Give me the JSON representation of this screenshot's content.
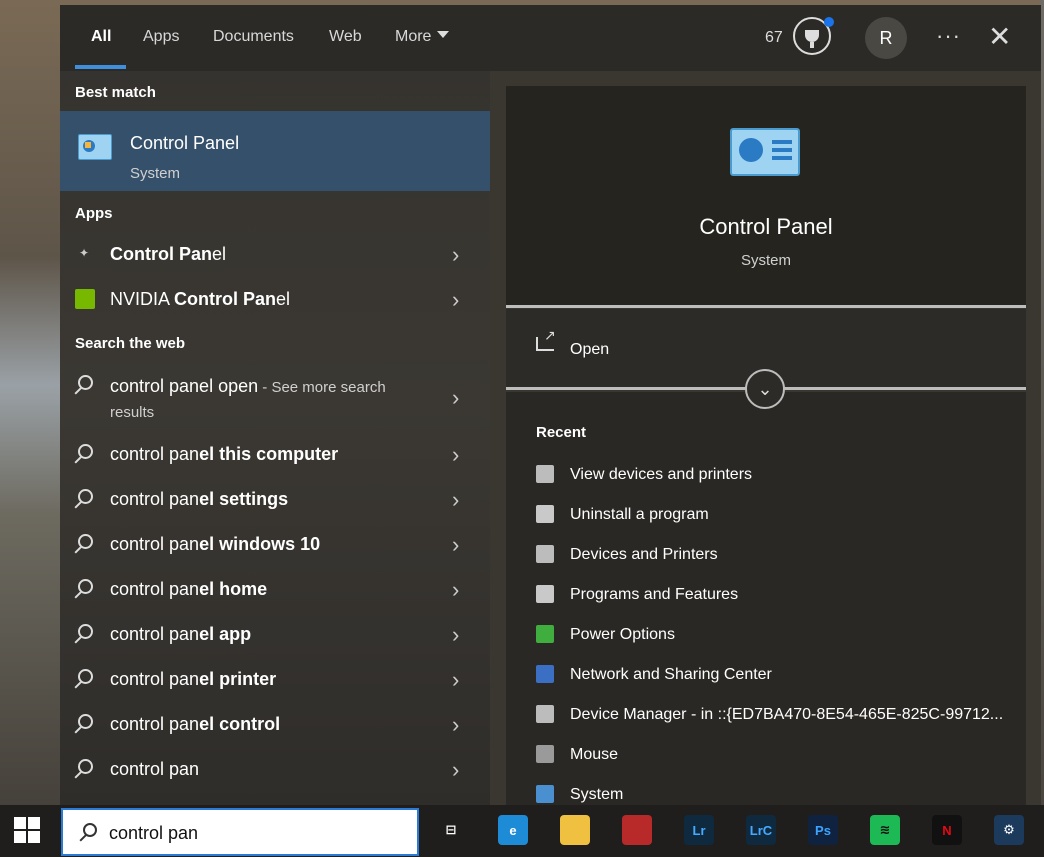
{
  "nav": {
    "tabs": [
      "All",
      "Apps",
      "Documents",
      "Web",
      "More"
    ],
    "points": "67",
    "avatar_initial": "R",
    "more_dots": "···",
    "close": "✕"
  },
  "sections": {
    "best_match": "Best match",
    "apps": "Apps",
    "search_web": "Search the web"
  },
  "best_match": {
    "title": "Control Panel",
    "subtitle": "System"
  },
  "apps": [
    {
      "prefix": "",
      "bold": "Control Pan",
      "suffix": "el"
    },
    {
      "prefix": "NVIDIA ",
      "bold": "Control Pan",
      "suffix": "el"
    }
  ],
  "web_open": {
    "main": "control panel open",
    "more": " - See more search",
    "line2": "results"
  },
  "web_results": [
    {
      "plain": "control pan",
      "bold": "el this computer"
    },
    {
      "plain": "control pan",
      "bold": "el settings"
    },
    {
      "plain": "control pan",
      "bold": "el windows 10"
    },
    {
      "plain": "control pan",
      "bold": "el home"
    },
    {
      "plain": "control pan",
      "bold": "el app"
    },
    {
      "plain": "control pan",
      "bold": "el printer"
    },
    {
      "plain": "control pan",
      "bold": "el control"
    },
    {
      "plain": "control pan",
      "bold": ""
    }
  ],
  "detail": {
    "title": "Control Panel",
    "subtitle": "System",
    "open_label": "Open",
    "recent_title": "Recent",
    "recent": [
      {
        "label": "View devices and printers",
        "icon": "printer-icon",
        "color": "#bcbcbc"
      },
      {
        "label": "Uninstall a program",
        "icon": "programs-icon",
        "color": "#c9c9c9"
      },
      {
        "label": "Devices and Printers",
        "icon": "printer-icon",
        "color": "#bcbcbc"
      },
      {
        "label": "Programs and Features",
        "icon": "programs-icon",
        "color": "#c9c9c9"
      },
      {
        "label": "Power Options",
        "icon": "power-icon",
        "color": "#3fae3f"
      },
      {
        "label": "Network and Sharing Center",
        "icon": "network-icon",
        "color": "#3b6fc4"
      },
      {
        "label": "Device Manager - in ::{ED7BA470-8E54-465E-825C-99712...",
        "icon": "device-manager-icon",
        "color": "#bcbcbc"
      },
      {
        "label": "Mouse",
        "icon": "mouse-icon",
        "color": "#9a9a9a"
      },
      {
        "label": "System",
        "icon": "system-icon",
        "color": "#4a8fd0"
      }
    ]
  },
  "taskbar": {
    "search_value": "control pan",
    "apps": [
      {
        "name": "task-view-icon",
        "text": "⊟",
        "bg": "transparent",
        "fg": "#ffffff"
      },
      {
        "name": "edge-icon",
        "text": "e",
        "bg": "#1e8bd6",
        "fg": "#ffffff"
      },
      {
        "name": "file-explorer-icon",
        "text": "",
        "bg": "#f0c040",
        "fg": "#ffffff"
      },
      {
        "name": "game-app-icon",
        "text": "",
        "bg": "#b82a2a",
        "fg": "#ffffff"
      },
      {
        "name": "lightroom-icon",
        "text": "Lr",
        "bg": "#0f2a3f",
        "fg": "#47a9ff"
      },
      {
        "name": "lightroom-classic-icon",
        "text": "LrC",
        "bg": "#0f2a3f",
        "fg": "#47a9ff"
      },
      {
        "name": "photoshop-icon",
        "text": "Ps",
        "bg": "#0f2240",
        "fg": "#3ca4ff"
      },
      {
        "name": "spotify-icon",
        "text": "≋",
        "bg": "#1db954",
        "fg": "#111111"
      },
      {
        "name": "netflix-icon",
        "text": "N",
        "bg": "#111111",
        "fg": "#e50914"
      },
      {
        "name": "steam-icon",
        "text": "⚙",
        "bg": "#1b3a5c",
        "fg": "#ffffff"
      }
    ]
  },
  "colors": {
    "accent": "#3f8fdc",
    "selected_bg": "#35506a"
  }
}
